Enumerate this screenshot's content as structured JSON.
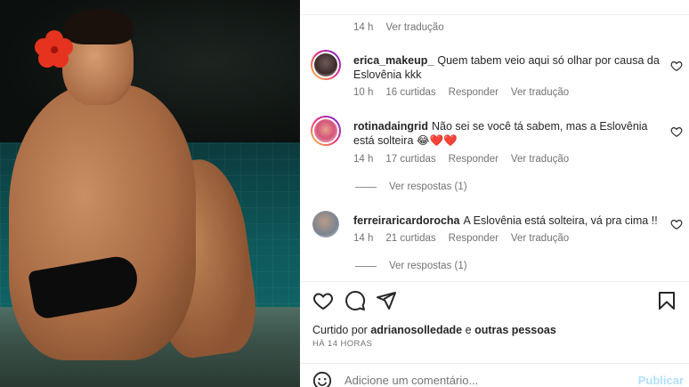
{
  "post_image": {
    "alt_subject": "photo"
  },
  "comments_panel": {
    "first_meta": {
      "time": "14 h",
      "translate": "Ver tradução"
    },
    "comments": [
      {
        "username": "erica_makeup_",
        "text": "Quem tabem veio aqui só olhar por causa da Eslovênia kkk",
        "time": "10 h",
        "likes": "16 curtidas",
        "reply": "Responder",
        "translate": "Ver tradução",
        "view_replies": ""
      },
      {
        "username": "rotinadaingrid",
        "text": "Não sei se você tá sabem, mas a Eslovênia está solteira 😂❤️❤️",
        "time": "14 h",
        "likes": "17 curtidas",
        "reply": "Responder",
        "translate": "Ver tradução",
        "view_replies": "Ver respostas (1)"
      },
      {
        "username": "ferreiraricardorocha",
        "text": "A Eslovênia está solteira, vá pra cima !!",
        "time": "14 h",
        "likes": "21 curtidas",
        "reply": "Responder",
        "translate": "Ver tradução",
        "view_replies": "Ver respostas (1)"
      }
    ]
  },
  "actions": {
    "like_icon": "heart-icon",
    "comment_icon": "comment-icon",
    "share_icon": "share-icon",
    "save_icon": "bookmark-icon"
  },
  "likes_line": {
    "prefix": "Curtido por",
    "user": "adrianosolledade",
    "suffix": "e",
    "others": "outras pessoas"
  },
  "time_ago": "HÁ 14 HORAS",
  "add_comment": {
    "placeholder": "Adicione um comentário...",
    "publish": "Publicar"
  },
  "colors": {
    "text": "#262626",
    "secondary": "#737373",
    "publish_disabled": "#b2dffc",
    "emoji_heart": "#ed4956"
  }
}
